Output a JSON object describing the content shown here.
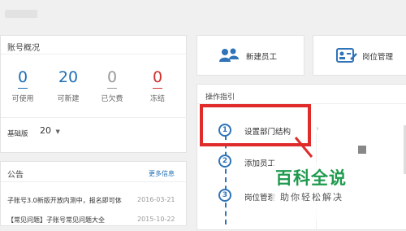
{
  "top_hint": "",
  "account": {
    "title": "账号概况",
    "stats": [
      {
        "value": "0",
        "label": "可使用",
        "color": "#1f6fb5"
      },
      {
        "value": "20",
        "label": "可新建",
        "color": "#1f6fb5"
      },
      {
        "value": "0",
        "label": "已欠费",
        "color": "#999999"
      },
      {
        "value": "0",
        "label": "冻结",
        "color": "#d0312d"
      }
    ],
    "edition_label": "基础版",
    "edition_value": "20"
  },
  "notice": {
    "title": "公告",
    "more": "更多信息",
    "items": [
      {
        "text": "子账号3.0新版开放内测中，报名即可体",
        "date": "2016-03-21"
      },
      {
        "text": "【常见问题】子账号常见问题大全",
        "date": "2015-10-22"
      }
    ]
  },
  "actions": {
    "new_employee": "新建员工",
    "position_manage": "岗位管理"
  },
  "guide": {
    "title": "操作指引",
    "steps": [
      {
        "num": "1",
        "label": "设置部门结构"
      },
      {
        "num": "2",
        "label": "添加员工"
      },
      {
        "num": "3",
        "label": "岗位管理"
      }
    ]
  },
  "watermark": {
    "title": "百科全说",
    "subtitle": "助你轻松解决"
  },
  "colors": {
    "accent": "#2f73b8",
    "highlight": "#e02b2b",
    "watermark_green": "#1e9a4e"
  }
}
